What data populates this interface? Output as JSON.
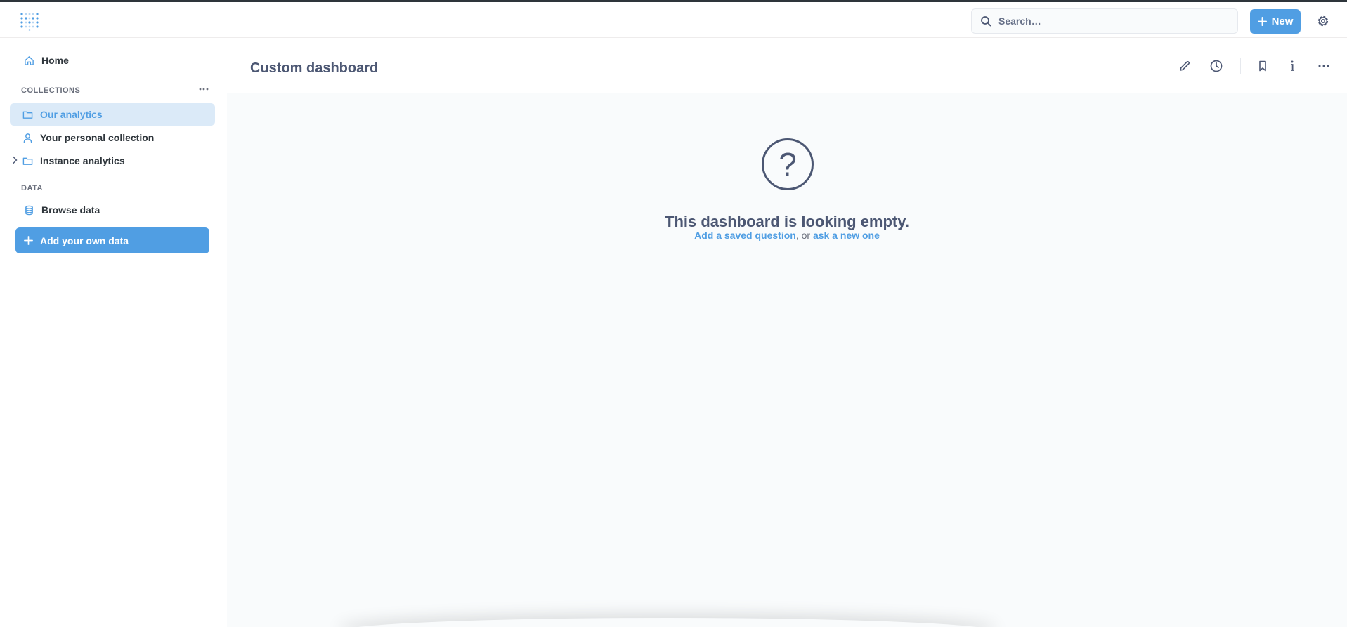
{
  "topbar": {
    "logo_icon": "metabase-logo",
    "search_placeholder": "Search…",
    "new_button_label": "New",
    "settings_icon": "gear-icon"
  },
  "sidebar": {
    "home_label": "Home",
    "collections_label": "COLLECTIONS",
    "items": [
      {
        "label": "Our analytics",
        "icon": "folder-icon",
        "active": true
      },
      {
        "label": "Your personal collection",
        "icon": "person-icon"
      },
      {
        "label": "Instance analytics",
        "icon": "folder-icon",
        "expandable": true
      }
    ],
    "data_label": "DATA",
    "browse_data_label": "Browse data",
    "add_data_label": "Add your own data"
  },
  "dashboard": {
    "title": "Custom dashboard",
    "empty_title": "This dashboard is looking empty.",
    "empty_link_saved": "Add a saved question",
    "empty_separator": ", or ",
    "empty_link_new": "ask a new one"
  },
  "colors": {
    "brand": "#509ee3",
    "active_bg": "#dbeaf8",
    "text": "#4c5773",
    "canvas_bg": "#f9fbfc"
  }
}
